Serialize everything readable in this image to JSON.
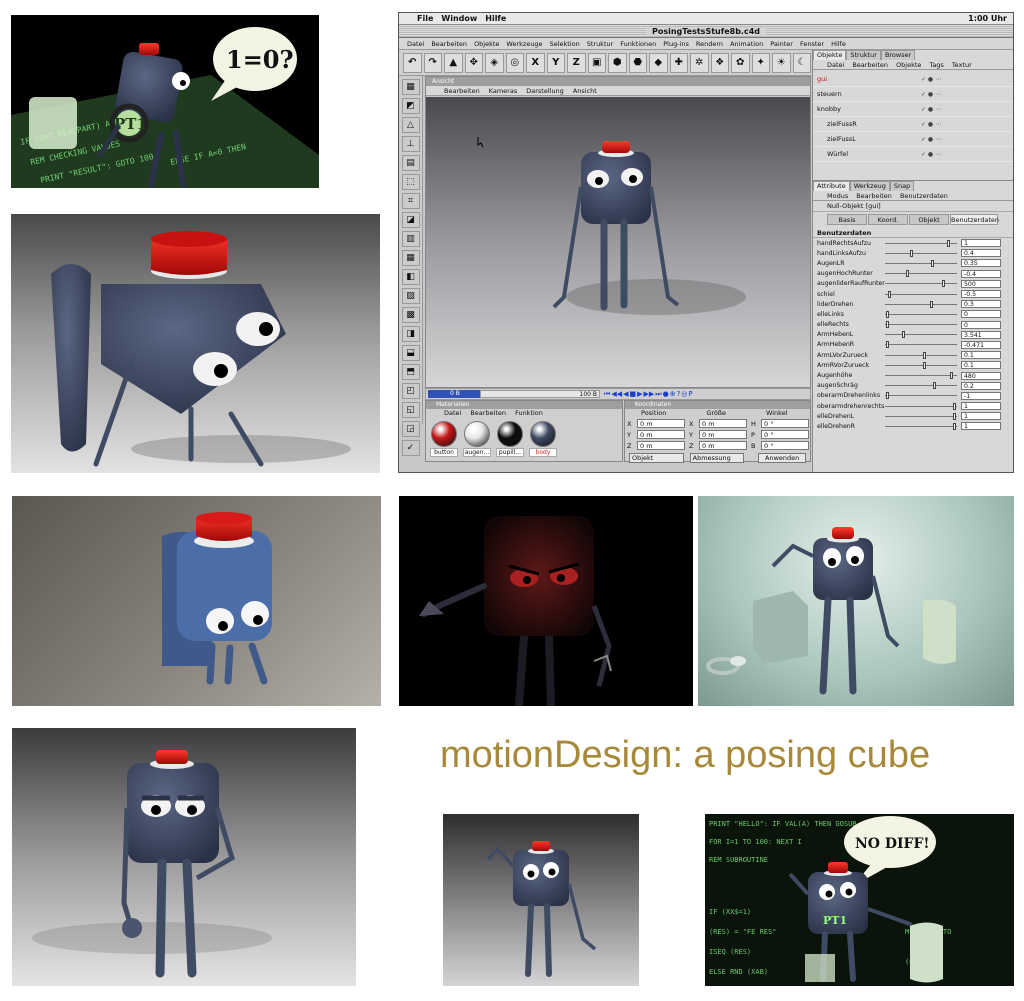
{
  "headline": "motionDesign: a posing cube",
  "renders": {
    "r1": {
      "bubble": "1=0?",
      "label": "PT1"
    },
    "r9": {
      "bubble": "NO DIFF!",
      "label": "PT1"
    }
  },
  "c4d": {
    "os_menu": [
      "File",
      "Window",
      "Hilfe"
    ],
    "clock": "1:00 Uhr",
    "title": "PosingTestsStufe8b.c4d",
    "app_menu": [
      "Datei",
      "Bearbeiten",
      "Objekte",
      "Werkzeuge",
      "Selektion",
      "Struktur",
      "Funktionen",
      "Plug-ins",
      "Rendern",
      "Animation",
      "Painter",
      "Fenster",
      "Hilfe"
    ],
    "toolbar": [
      "↶",
      "↷",
      "▲",
      "✥",
      "◈",
      "◎",
      "X",
      "Y",
      "Z",
      "▣",
      "⬢",
      "⬣",
      "◆",
      "✚",
      "✲",
      "❖",
      "✿",
      "✦",
      "☀",
      "☾"
    ],
    "left_tools": [
      "▦",
      "◩",
      "△",
      "⊥",
      "▤",
      "⬚",
      "⌗",
      "◪",
      "▥",
      "▦",
      "◧",
      "▨",
      "▩",
      "◨",
      "⬓",
      "⬒",
      "◰",
      "◱",
      "◲",
      "✓"
    ],
    "viewport": {
      "header": "Ansicht",
      "menu": [
        "Bearbeiten",
        "Kameras",
        "Darstellung",
        "Ansicht"
      ]
    },
    "timeline": {
      "current": "0 B",
      "end": "100 B",
      "controls": [
        "⏮",
        "◀◀",
        "◀",
        "■",
        "▶",
        "▶▶",
        "⏭",
        "●",
        "⊕",
        "?",
        "◎",
        "P"
      ]
    },
    "materials": {
      "header": "Materialien",
      "menu": [
        "Datei",
        "Bearbeiten",
        "Funktion"
      ],
      "items": [
        {
          "name": "button",
          "color": "#c41616",
          "selected": false
        },
        {
          "name": "augen...",
          "color": "#e8e8e8",
          "selected": false
        },
        {
          "name": "pupill...",
          "color": "#0c0c0c",
          "selected": false
        },
        {
          "name": "body",
          "color": "#3f4a63",
          "selected": true
        }
      ]
    },
    "coordinates": {
      "header": "Koordinaten",
      "cols": [
        "Position",
        "Größe",
        "Winkel"
      ],
      "rows": [
        {
          "a1": "X",
          "v1": "0 m",
          "a2": "X",
          "v2": "0 m",
          "a3": "H",
          "v3": "0 °"
        },
        {
          "a1": "Y",
          "v1": "0 m",
          "a2": "Y",
          "v2": "0 m",
          "a3": "P",
          "v3": "0 °"
        },
        {
          "a1": "Z",
          "v1": "0 m",
          "a2": "Z",
          "v2": "0 m",
          "a3": "B",
          "v3": "0 °"
        }
      ],
      "mode": "Objekt",
      "size_mode": "Abmessung",
      "apply": "Anwenden"
    },
    "objects": {
      "tabs": [
        "Objekte",
        "Struktur",
        "Browser"
      ],
      "menu": [
        "Datei",
        "Bearbeiten",
        "Objekte",
        "Tags",
        "Textur"
      ],
      "items": [
        "gui",
        "steuern",
        "knobby",
        "zielFussR",
        "zielFussL",
        "Würfel"
      ]
    },
    "attributes": {
      "tabs": [
        "Attribute",
        "Werkzeug",
        "Snap"
      ],
      "menu": [
        "Modus",
        "Bearbeiten",
        "Benutzerdaten"
      ],
      "object_title": "Null-Objekt [gui]",
      "subtabs": [
        "Basis",
        "Koord.",
        "Objekt",
        "Benutzerdaten"
      ],
      "section": "Benutzerdaten",
      "params": [
        {
          "name": "handRechtsAufzu",
          "value": "1",
          "level": 0.9
        },
        {
          "name": "handLinksAufzu",
          "value": "0.4",
          "level": 0.36
        },
        {
          "name": "AugenLR",
          "value": "0.35",
          "level": 0.66
        },
        {
          "name": "augenHochRunter",
          "value": "-0.4",
          "level": 0.3
        },
        {
          "name": "augenliderRaufRunter",
          "value": "500",
          "level": 0.82
        },
        {
          "name": "schiel",
          "value": "-0.5",
          "level": 0.04
        },
        {
          "name": "liderDrehen",
          "value": "0.3",
          "level": 0.65
        },
        {
          "name": "elleLinks",
          "value": "0",
          "level": 0.02
        },
        {
          "name": "elleRechts",
          "value": "0",
          "level": 0.02
        },
        {
          "name": "ArmHebenL",
          "value": "3.541",
          "level": 0.25
        },
        {
          "name": "ArmHebenR",
          "value": "-0.471",
          "level": 0.02
        },
        {
          "name": "ArmLVorZurueck",
          "value": "0.1",
          "level": 0.55
        },
        {
          "name": "ArmRVorZurueck",
          "value": "0.1",
          "level": 0.55
        },
        {
          "name": "Augenhöhe",
          "value": "480",
          "level": 0.94
        },
        {
          "name": "augenSchräg",
          "value": "0.2",
          "level": 0.7
        },
        {
          "name": "oberarmDrehenlinks",
          "value": "-1",
          "level": 0.02
        },
        {
          "name": "oberarmdrehenrechts",
          "value": "1",
          "level": 0.98
        },
        {
          "name": "elleDrehenL",
          "value": "1",
          "level": 0.98
        },
        {
          "name": "elleDrehenR",
          "value": "1",
          "level": 0.98
        }
      ]
    }
  },
  "colors": {
    "headline": "#a8893a",
    "cube_body": "#3f4a63",
    "button": "#c41616",
    "code_green": "#8cff8c",
    "timeline_blue": "#2f51b9"
  }
}
